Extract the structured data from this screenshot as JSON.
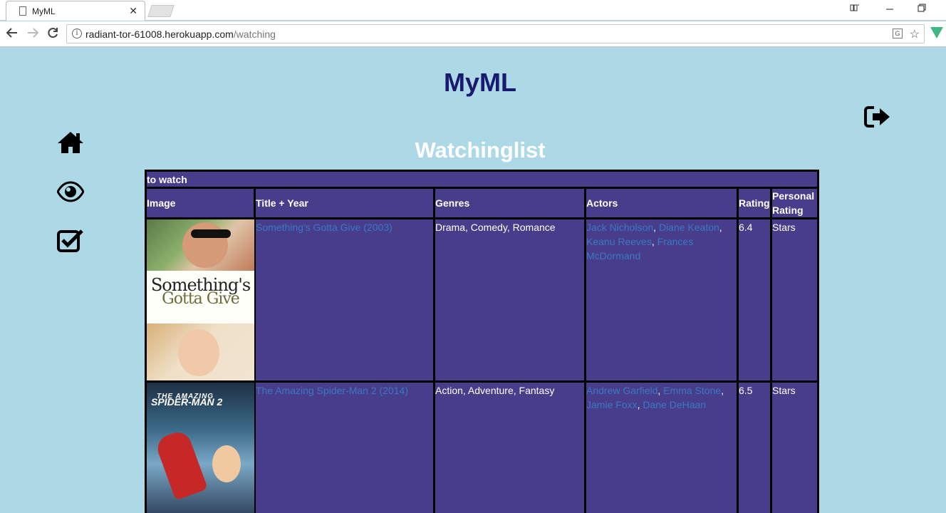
{
  "browser": {
    "tab_title": "MyML",
    "tab_close": "✕",
    "url_host": "radiant-tor-61008.herokuapp.com",
    "url_path": "/watching",
    "win_controls": [
      "🗕",
      "—",
      "❐"
    ]
  },
  "site": {
    "title": "MyML"
  },
  "page": {
    "heading": "Watchinglist"
  },
  "nav": {
    "items": [
      {
        "name": "home-icon"
      },
      {
        "name": "eye-icon"
      },
      {
        "name": "check-square-icon"
      }
    ],
    "logout_icon": "sign-out-icon"
  },
  "table": {
    "caption": "to watch",
    "headers": {
      "image": "Image",
      "title": "Title + Year",
      "genres": "Genres",
      "actors": "Actors",
      "rating": "Rating",
      "personal": "Personal Rating"
    },
    "rows": [
      {
        "title": "Something's Gotta Give (2003)",
        "poster_line1": "Something's",
        "poster_line2": "Gotta Give",
        "genres": "Drama, Comedy, Romance",
        "actors": [
          "Jack Nicholson",
          "Diane Keaton",
          "Keanu Reeves",
          "Frances McDormand"
        ],
        "rating": "6.4",
        "personal": "Stars"
      },
      {
        "title": "The Amazing Spider-Man 2 (2014)",
        "poster_line1": "THE AMAZING",
        "poster_line2": "SPIDER-MAN 2",
        "genres": "Action, Adventure, Fantasy",
        "actors": [
          "Andrew Garfield",
          "Emma Stone",
          "Jamie Foxx",
          "Dane DeHaan"
        ],
        "rating": "6.5",
        "personal": "Stars"
      }
    ]
  }
}
